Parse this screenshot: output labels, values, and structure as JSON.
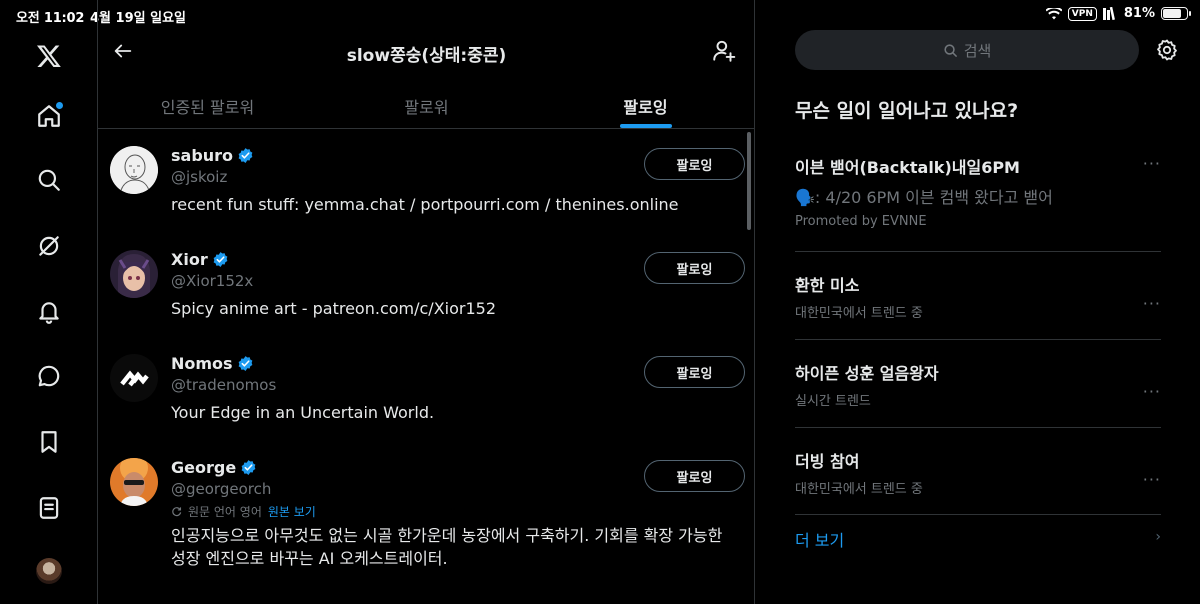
{
  "status": {
    "time": "오전 11:02",
    "date": "4월 19일 일요일",
    "vpn": "VPN",
    "battery": "81%",
    "battery_level": 0.81
  },
  "header": {
    "title": "slow쫑숭(상태:중콘)"
  },
  "tabs": [
    {
      "label": "인증된 팔로워",
      "active": false
    },
    {
      "label": "팔로워",
      "active": false
    },
    {
      "label": "팔로잉",
      "active": true
    }
  ],
  "users": [
    {
      "name": "saburo",
      "handle": "@jskoiz",
      "bio": "recent fun stuff: yemma.chat / portpourri.com / thenines.online",
      "button": "팔로잉"
    },
    {
      "name": "Xior",
      "handle": "@Xior152x",
      "bio": "Spicy anime art - patreon.com/c/Xior152",
      "button": "팔로잉"
    },
    {
      "name": "Nomos",
      "handle": "@tradenomos",
      "bio": "Your Edge in an Uncertain World.",
      "button": "팔로잉"
    },
    {
      "name": "George",
      "handle": "@georgeorch",
      "translation_note": "원문 언어 영어",
      "translation_link": "원본 보기",
      "bio": "인공지능으로 아무것도 없는 시골 한가운데 농장에서 구축하기. 기회를 확장 가능한 성장 엔진으로 바꾸는 AI 오케스트레이터.",
      "button": "팔로잉"
    }
  ],
  "search": {
    "placeholder": "검색"
  },
  "trends": {
    "title": "무슨 일이 일어나고 있나요?",
    "items": [
      {
        "title": "이븐 밷어(Backtalk)내일6PM",
        "subtitle": "🗣️: 4/20 6PM 이븐 컴백 왔다고 밷어",
        "meta": "Promoted by EVNNE"
      },
      {
        "title": "환한 미소",
        "meta": "대한민국에서 트렌드 중"
      },
      {
        "title": "하이픈 성훈 얼음왕자",
        "meta": "실시간 트렌드"
      },
      {
        "title": "더빙 참여",
        "meta": "대한민국에서 트렌드 중"
      }
    ],
    "more_label": "더 보기",
    "more_icon": "chevron-right-icon",
    "dots": "···"
  },
  "colors": {
    "accent": "#1d9bf0",
    "background": "#000000",
    "border": "#2f3336",
    "muted": "#71767b"
  }
}
